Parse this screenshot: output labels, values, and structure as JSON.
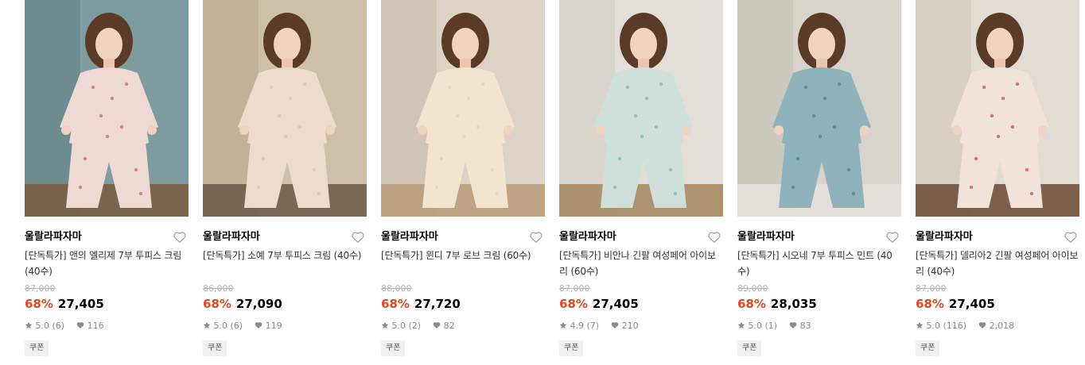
{
  "products": [
    {
      "brand": "울랄라파자마",
      "title": "[단독특가] 앤의 엘리제 7부 투피스 크림 (40수)",
      "original_price": "87,000",
      "discount": "68%",
      "price": "27,405",
      "rating": "5.0 (6)",
      "likes": "116",
      "badge": "쿠폰",
      "palette": {
        "bg": "#7e9c9f",
        "bg2": "#5d7f83",
        "garment": "#efd9d4",
        "accent": "#c9676f",
        "floor": "#7a5b3e"
      }
    },
    {
      "brand": "울랄라파자마",
      "title": "[단독특가] 소예 7부 투피스 크림 (40수)",
      "original_price": "86,000",
      "discount": "68%",
      "price": "27,090",
      "rating": "5.0 (6)",
      "likes": "119",
      "badge": "쿠폰",
      "palette": {
        "bg": "#cdbfa8",
        "bg2": "#b9a88e",
        "garment": "#ecdcc9",
        "accent": "#d8c2ac",
        "floor": "#6b5744"
      }
    },
    {
      "brand": "울랄라파자마",
      "title": "[단독특가] 윈디 7부 로브 크림 (60수)",
      "original_price": "88,000",
      "discount": "68%",
      "price": "27,720",
      "rating": "5.0 (2)",
      "likes": "82",
      "badge": "쿠폰",
      "palette": {
        "bg": "#dcd3c6",
        "bg2": "#c9bca9",
        "garment": "#f2e4cf",
        "accent": "#e6d2b4",
        "floor": "#b89b78"
      }
    },
    {
      "brand": "울랄라파자마",
      "title": "[단독특가] 비안나 긴팔 여성페어 아이보리 (60수)",
      "original_price": "87,000",
      "discount": "68%",
      "price": "27,405",
      "rating": "4.9 (7)",
      "likes": "210",
      "badge": "쿠폰",
      "palette": {
        "bg": "#e3dfd8",
        "bg2": "#d2ccc2",
        "garment": "#cfe0db",
        "accent": "#7fb5b4",
        "floor": "#a4865f"
      }
    },
    {
      "brand": "울랄라파자마",
      "title": "[단독특가] 시오네 7부 투피스 민트 (40수)",
      "original_price": "89,000",
      "discount": "68%",
      "price": "28,035",
      "rating": "5.0 (1)",
      "likes": "83",
      "badge": "쿠폰",
      "palette": {
        "bg": "#d8d4cc",
        "bg2": "#c5c0b5",
        "garment": "#8fb3bd",
        "accent": "#4f7f8c",
        "floor": "#e6e2da"
      }
    },
    {
      "brand": "울랄라파자마",
      "title": "[단독특가] 델리아2 긴팔 여성페어 아이보리 (40수)",
      "original_price": "87,000",
      "discount": "68%",
      "price": "27,405",
      "rating": "5.0 (116)",
      "likes": "2,018",
      "badge": "쿠폰",
      "palette": {
        "bg": "#e2dcd4",
        "bg2": "#cfc6ba",
        "garment": "#f1e3dc",
        "accent": "#c4505a",
        "floor": "#6a4a32"
      }
    }
  ]
}
